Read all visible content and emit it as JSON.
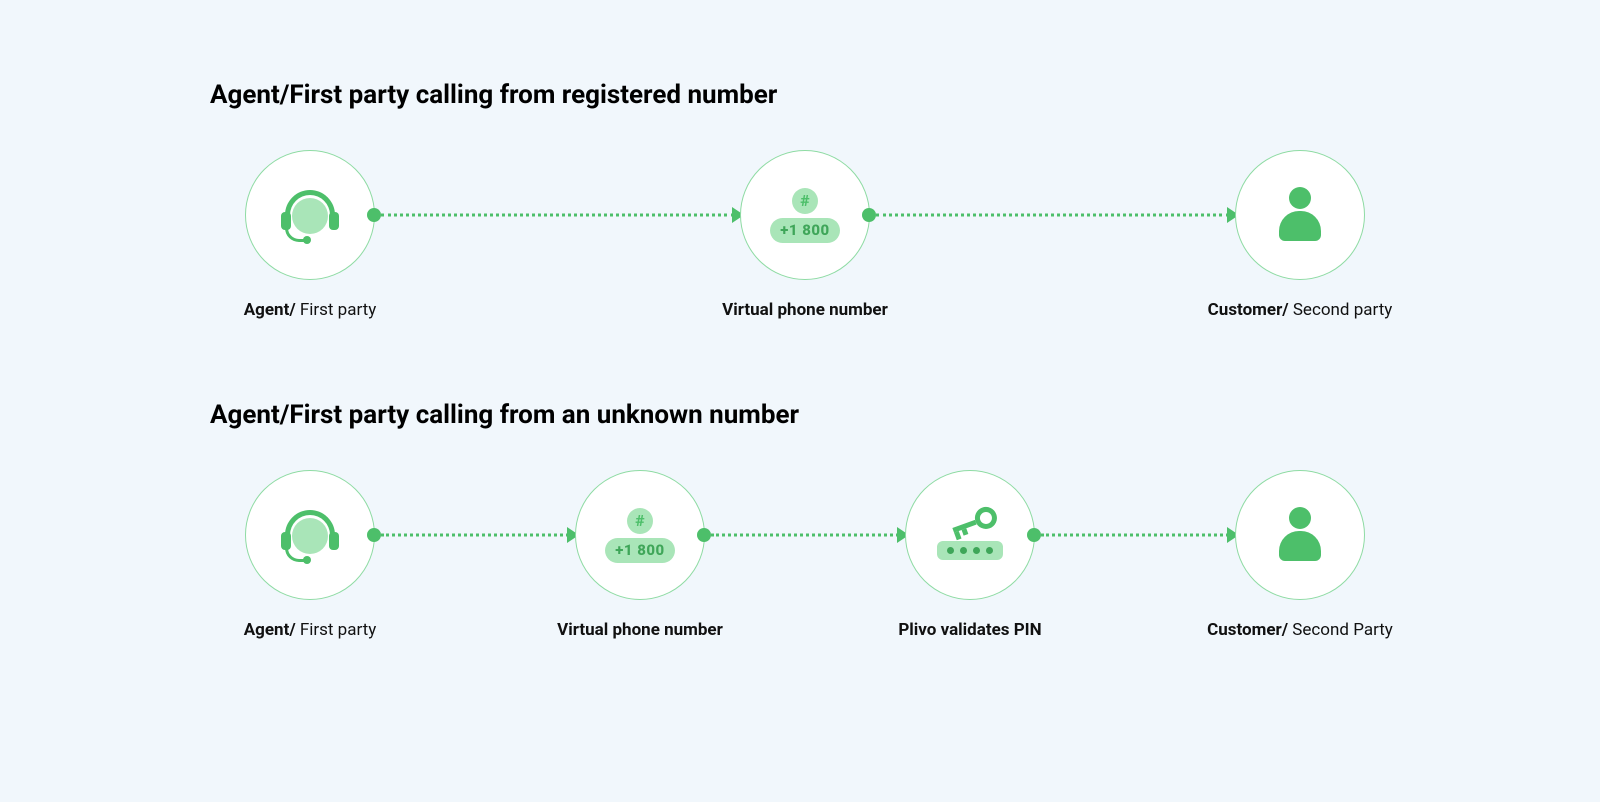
{
  "colors": {
    "accent": "#4DBF6A",
    "accent_light": "#A9E5B8",
    "bg": "#F1F7FC"
  },
  "sections": {
    "registered": {
      "title": "Agent/First party calling from registered number",
      "nodes": {
        "agent": {
          "bold": "Agent/",
          "rest": " First party",
          "icon": "headset"
        },
        "virtual": {
          "bold": "Virtual phone number",
          "rest": "",
          "icon": "phone",
          "hash": "#",
          "pill": "+1 800"
        },
        "customer": {
          "bold": "Customer/",
          "rest": " Second party",
          "icon": "user"
        }
      }
    },
    "unknown": {
      "title": "Agent/First party calling from an unknown number",
      "nodes": {
        "agent": {
          "bold": "Agent/",
          "rest": " First party",
          "icon": "headset"
        },
        "virtual": {
          "bold": "Virtual phone number",
          "rest": "",
          "icon": "phone",
          "hash": "#",
          "pill": "+1 800"
        },
        "pin": {
          "bold": "Plivo validates PIN",
          "rest": "",
          "icon": "pin"
        },
        "customer": {
          "bold": "Customer/",
          "rest": " Second Party",
          "icon": "user"
        }
      }
    }
  }
}
